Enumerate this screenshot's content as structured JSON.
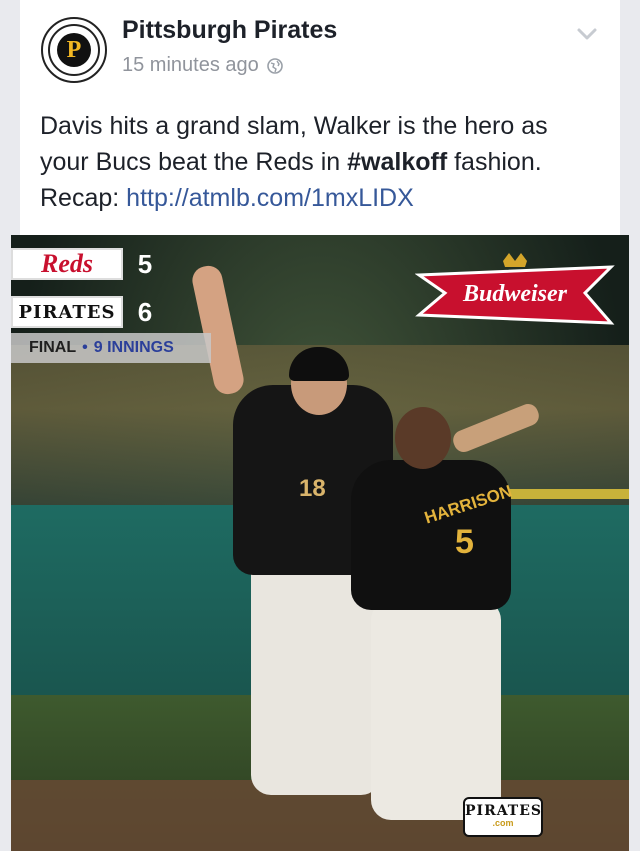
{
  "post": {
    "page_name": "Pittsburgh Pirates",
    "time": "15 minutes ago",
    "avatar_letter": "P",
    "text_prefix": "Davis hits a grand slam, Walker is the hero as your Bucs beat the Reds in ",
    "hashtag": "#walkoff",
    "text_suffix": " fashion. Recap: ",
    "link": "http://atmlb.com/1mxLIDX"
  },
  "graphic": {
    "team1": "Reds",
    "team1_runs": "5",
    "team2": "PIRATES",
    "team2_runs": "6",
    "final_label": "FINAL",
    "bullet": "•",
    "innings": "9 INNINGS",
    "sponsor": "Budweiser",
    "player1_number": "18",
    "player2_name": "HARRISON",
    "player2_number": "5",
    "logo_word": "PIRATES",
    "logo_domain": ".com"
  },
  "colors": {
    "link": "#365899",
    "reds_red": "#c8102e",
    "pirates_gold": "#f4b823"
  }
}
